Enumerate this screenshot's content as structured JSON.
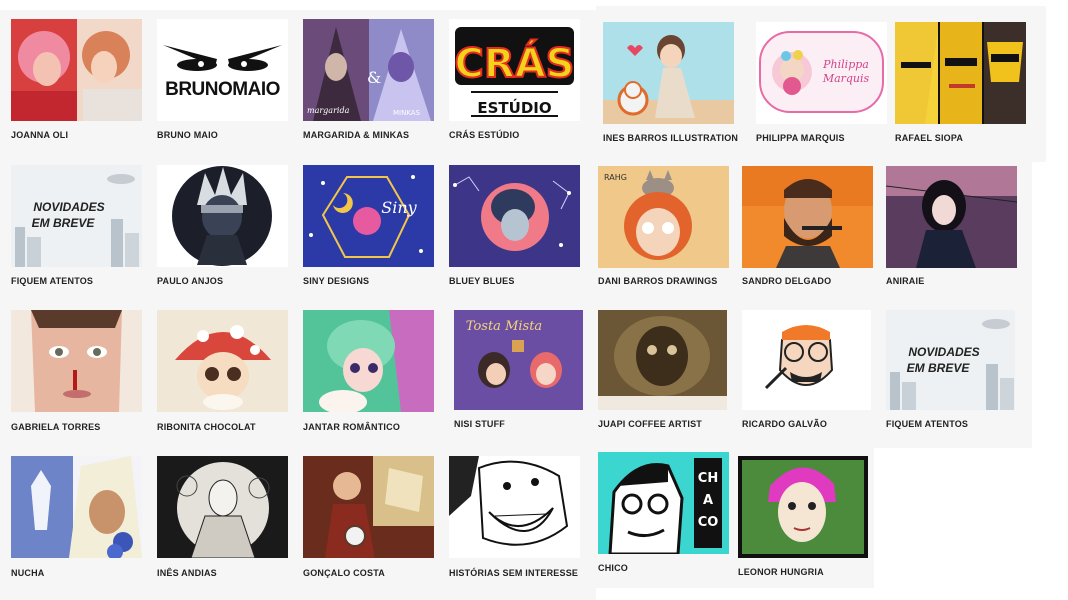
{
  "artists": [
    {
      "name": "JOANNA OLI",
      "thumb": "pink-portraits"
    },
    {
      "name": "BRUNO MAIO",
      "thumb": "logo-eyes",
      "logo_text": "BRUNOMAIO"
    },
    {
      "name": "MARGARIDA & MINKAS",
      "thumb": "twin-illustration",
      "logo_text": "margarida & MINKAS"
    },
    {
      "name": "CRÁS ESTÚDIO",
      "thumb": "cras-logo",
      "logo_text": "CRÁS",
      "logo_sub": "ESTÚDIO"
    },
    {
      "name": "INES BARROS ILLUSTRATION",
      "thumb": "girl-robot"
    },
    {
      "name": "PHILIPPA MARQUIS",
      "thumb": "philippa-logo",
      "logo_text": "Philippa Marquis"
    },
    {
      "name": "RAFAEL SIOPA",
      "thumb": "hero-panels"
    },
    {
      "name": "FIQUEM ATENTOS",
      "thumb": "coming-soon",
      "logo_text": "NOVIDADES EM BREVE"
    },
    {
      "name": "PAULO ANJOS",
      "thumb": "ninja-circle"
    },
    {
      "name": "SINY DESIGNS",
      "thumb": "night-terrarium",
      "logo_text": "Siny"
    },
    {
      "name": "BLUEY BLUES",
      "thumb": "constellation-portrait"
    },
    {
      "name": "DANI BARROS DRAWINGS",
      "thumb": "redhead-cat"
    },
    {
      "name": "SANDRO DELGADO",
      "thumb": "bearded-man"
    },
    {
      "name": "ANIRAIE",
      "thumb": "night-girl"
    },
    {
      "name": "GABRIELA TORRES",
      "thumb": "face-closeup"
    },
    {
      "name": "RIBONITA CHOCOLAT",
      "thumb": "mushroom-girl"
    },
    {
      "name": "JANTAR ROMÂNTICO",
      "thumb": "green-hair-girl"
    },
    {
      "name": "NISI STUFF",
      "thumb": "toasting-couple",
      "logo_text": "Tosta Mista"
    },
    {
      "name": "JUAPI COFFEE ARTIST",
      "thumb": "coffee-art"
    },
    {
      "name": "RICARDO GALVÃO",
      "thumb": "glasses-sketch"
    },
    {
      "name": "FIQUEM ATENTOS",
      "thumb": "coming-soon",
      "logo_text": "NOVIDADES EM BREVE"
    },
    {
      "name": "NUCHA",
      "thumb": "crystal-blonde"
    },
    {
      "name": "INÊS ANDIAS",
      "thumb": "lineart-bw"
    },
    {
      "name": "GONÇALO COSTA",
      "thumb": "monk-map"
    },
    {
      "name": "HISTÓRIAS SEM INTERESSE",
      "thumb": "laughing-face"
    },
    {
      "name": "CHICO",
      "thumb": "chico-cartoon",
      "logo_text": "CHACO"
    },
    {
      "name": "LEONOR HUNGRIA",
      "thumb": "pink-hair-woman"
    }
  ]
}
